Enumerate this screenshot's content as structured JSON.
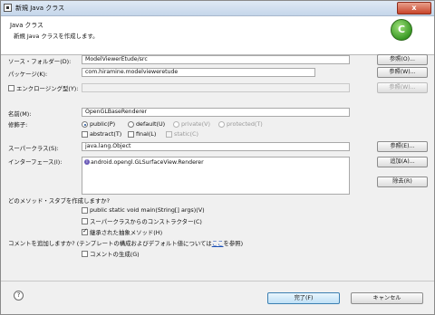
{
  "window": {
    "title": "新規 Java クラス",
    "close": "x"
  },
  "header": {
    "title": "Java クラス",
    "message": "新規 Java クラスを作成します。",
    "logo": "C"
  },
  "source_folder": {
    "label": "ソース・フォルダー(D):",
    "value": "ModelViewerEtude/src",
    "browse": "参照(O)..."
  },
  "package": {
    "label": "パッケージ(K):",
    "value": "com.hiramine.modelvieweretude",
    "browse": "参照(W)..."
  },
  "enclosing": {
    "label": "エンクロージング型(Y):",
    "value": "",
    "browse": "参照(W)..."
  },
  "name": {
    "label": "名前(M):",
    "value": "OpenGLBaseRenderer"
  },
  "modifiers": {
    "label": "修飾子:",
    "public": "public(P)",
    "default": "default(U)",
    "private": "private(V)",
    "protected": "protected(T)",
    "abstract": "abstract(T)",
    "final": "final(L)",
    "static": "static(C)"
  },
  "superclass": {
    "label": "スーパークラス(S):",
    "value": "java.lang.Object",
    "browse": "参照(E)..."
  },
  "interfaces": {
    "label": "インターフェース(I):",
    "items": [
      "android.opengl.GLSurfaceView.Renderer"
    ],
    "icon": "i",
    "add": "追加(A)...",
    "remove": "除去(R)"
  },
  "stubs": {
    "question": "どのメソッド・スタブを作成しますか?",
    "main": "public static void main(String[] args)(V)",
    "constructors": "スーパークラスからのコンストラクター(C)",
    "inherited": "継承された抽象メソッド(H)"
  },
  "comments": {
    "question_prefix": "コメントを追加しますか? (テンプレートの構成およびデフォルト値については",
    "question_link": "ここ",
    "question_suffix": "を参照)",
    "generate": "コメントの生成(G)"
  },
  "footer": {
    "help": "?",
    "finish": "完了(F)",
    "cancel": "キャンセル"
  }
}
